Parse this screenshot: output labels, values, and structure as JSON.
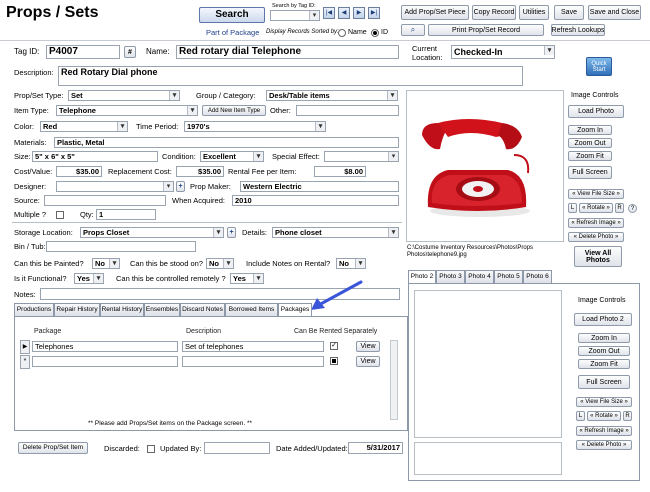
{
  "app": {
    "title": "Props / Sets"
  },
  "header": {
    "search_label": "Search",
    "search_by_tag_label": "Search by Tag ID:",
    "part_of_package_label": "Part of Package",
    "display_sorted_label": "Display Records Sorted by:",
    "sort_name_label": "Name",
    "sort_id_label": "ID",
    "sort_selected": "ID"
  },
  "toolbar": {
    "add_label": "Add Prop/Set Piece",
    "copy_label": "Copy Record",
    "utilities_label": "Utilities",
    "save_label": "Save",
    "save_close_label": "Save and Close",
    "print_label": "Print Prop/Set Record",
    "refresh_label": "Refresh Lookups"
  },
  "record": {
    "tag_id_label": "Tag ID:",
    "tag_id": "P4007",
    "hash_label": "#",
    "name_label": "Name:",
    "name": "Red rotary dial Telephone",
    "location_label_1": "Current",
    "location_label_2": "Location:",
    "location": "Checked-In",
    "description_label": "Description:",
    "description": "Red Rotary Dial phone",
    "type_label": "Prop/Set Type:",
    "type": "Set",
    "group_label": "Group / Category:",
    "group": "Desk/Table items",
    "item_type_label": "Item Type:",
    "item_type": "Telephone",
    "add_item_type_label": "Add New Item Type",
    "other_label": "Other:",
    "other": "",
    "color_label": "Color:",
    "color": "Red",
    "time_period_label": "Time Period:",
    "time_period": "1970's",
    "materials_label": "Materials:",
    "materials": "Plastic, Metal",
    "size_label": "Size:",
    "size": "5\" x 6\" x 5\"",
    "condition_label": "Condition:",
    "condition": "Excellent",
    "special_effect_label": "Special Effect:",
    "special_effect": "",
    "cost_label": "Cost/Value:",
    "cost": "$35.00",
    "replacement_label": "Replacement Cost:",
    "replacement": "$35.00",
    "rental_fee_label": "Rental Fee per Item:",
    "rental_fee": "$8.00",
    "designer_label": "Designer:",
    "designer": "",
    "plus_label": "+",
    "prop_maker_label": "Prop Maker:",
    "prop_maker": "Western Electric",
    "source_label": "Source:",
    "source": "",
    "when_acquired_label": "When Acquired:",
    "when_acquired": "2010",
    "multiple_label": "Multiple ?",
    "qty_label": "Qty:",
    "qty": "1",
    "storage_label": "Storage Location:",
    "storage": "Props Closet",
    "details_label": "Details:",
    "details": "Phone closet",
    "bin_label": "Bin / Tub:",
    "bin": "",
    "painted_label": "Can this be Painted?",
    "painted": "No",
    "stood_label": "Can this be stood on?",
    "stood": "No",
    "notes_rental_label": "Include Notes on Rental?",
    "notes_rental": "No",
    "functional_label": "Is it Functional?",
    "functional": "Yes",
    "remote_label": "Can this be controlled remotely ?",
    "remote": "Yes",
    "notes_label": "Notes:",
    "notes": ""
  },
  "tabs": [
    "Productions",
    "Repair History",
    "Rental History",
    "Ensembles",
    "Discard Notes",
    "Borrowed Items",
    "Packages"
  ],
  "active_tab": "Packages",
  "packages": {
    "col_package": "Package",
    "col_description": "Description",
    "col_rentable": "Can Be Rented Separately",
    "rows": [
      {
        "package": "Telephones",
        "description": "Set of telephones",
        "view": "View"
      },
      {
        "package": "",
        "description": "",
        "view": "View"
      }
    ],
    "note": "** Please add Props/Set items on the Package screen. **"
  },
  "footer": {
    "delete_label": "Delete Prop/Set Item",
    "discarded_label": "Discarded:",
    "updated_by_label": "Updated By:",
    "updated_by": "",
    "date_label": "Date Added/Updated:",
    "date": "5/31/2017"
  },
  "photo": {
    "path": "C:\\Costume Inventory Resources\\Photos\\Props Photos\\telephone9.jpg",
    "controls_label": "Image Controls",
    "load_label": "Load Photo",
    "zoom_in_label": "Zoom In",
    "zoom_out_label": "Zoom Out",
    "zoom_fit_label": "Zoom Fit",
    "full_screen_label": "Full Screen",
    "view_size_label": "« View File Size »",
    "l_label": "L",
    "rotate_label": "« Rotate »",
    "r_label": "R",
    "help_label": "?",
    "refresh_image_label": "« Refresh Image »",
    "delete_photo_label": "« Delete Photo »",
    "view_all_label": "View All Photos",
    "quick_start_label": "Quick Start"
  },
  "photo_tabs": [
    "Photo 2",
    "Photo 3",
    "Photo 4",
    "Photo 5",
    "Photo 6"
  ],
  "photo2": {
    "controls_label": "Image Controls",
    "load_label": "Load Photo 2",
    "zoom_in_label": "Zoom In",
    "zoom_out_label": "Zoom Out",
    "zoom_fit_label": "Zoom Fit",
    "full_screen_label": "Full Screen",
    "view_size_label": "« View File Size »",
    "l_label": "L",
    "rotate_label": "« Rotate »",
    "r_label": "R",
    "refresh_image_label": "« Refresh Image »",
    "delete_photo_label": "« Delete Photo »"
  },
  "colors": {
    "annotation_arrow": "#3b55d9",
    "phone_red": "#d1121b"
  }
}
